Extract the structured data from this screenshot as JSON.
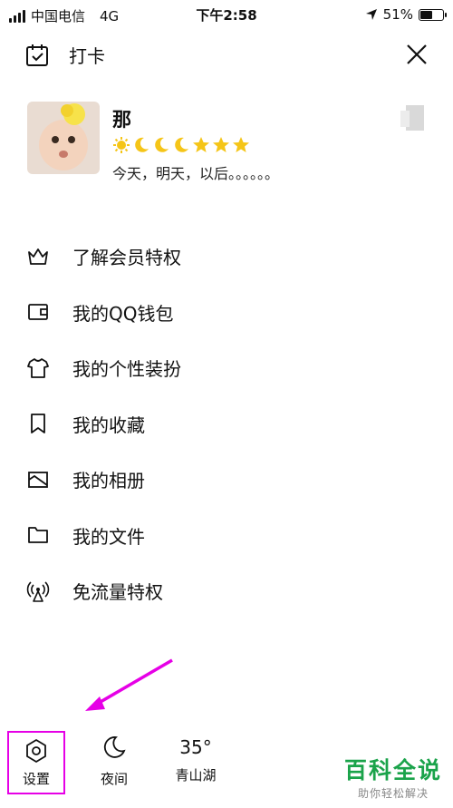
{
  "status_bar": {
    "carrier": "中国电信",
    "network": "4G",
    "time": "下午2:58",
    "battery": "51%"
  },
  "header": {
    "checkin_label": "打卡"
  },
  "profile": {
    "name": "那",
    "signature": "今天，明天，以后。。。。。。"
  },
  "menu": {
    "items": [
      {
        "label": "了解会员特权",
        "icon": "crown-icon"
      },
      {
        "label": "我的QQ钱包",
        "icon": "wallet-icon"
      },
      {
        "label": "我的个性装扮",
        "icon": "tshirt-icon"
      },
      {
        "label": "我的收藏",
        "icon": "bookmark-icon"
      },
      {
        "label": "我的相册",
        "icon": "album-icon"
      },
      {
        "label": "我的文件",
        "icon": "folder-icon"
      },
      {
        "label": "免流量特权",
        "icon": "signal-tower-icon"
      }
    ]
  },
  "bottom": {
    "settings_label": "设置",
    "night_label": "夜间",
    "temperature": "35°",
    "location": "青山湖"
  },
  "watermark": {
    "main": "百科全说",
    "sub": "助你轻松解决"
  },
  "colors": {
    "highlight": "#e600e6",
    "watermark_green": "#1aa34a",
    "star_yellow": "#f5c518"
  }
}
